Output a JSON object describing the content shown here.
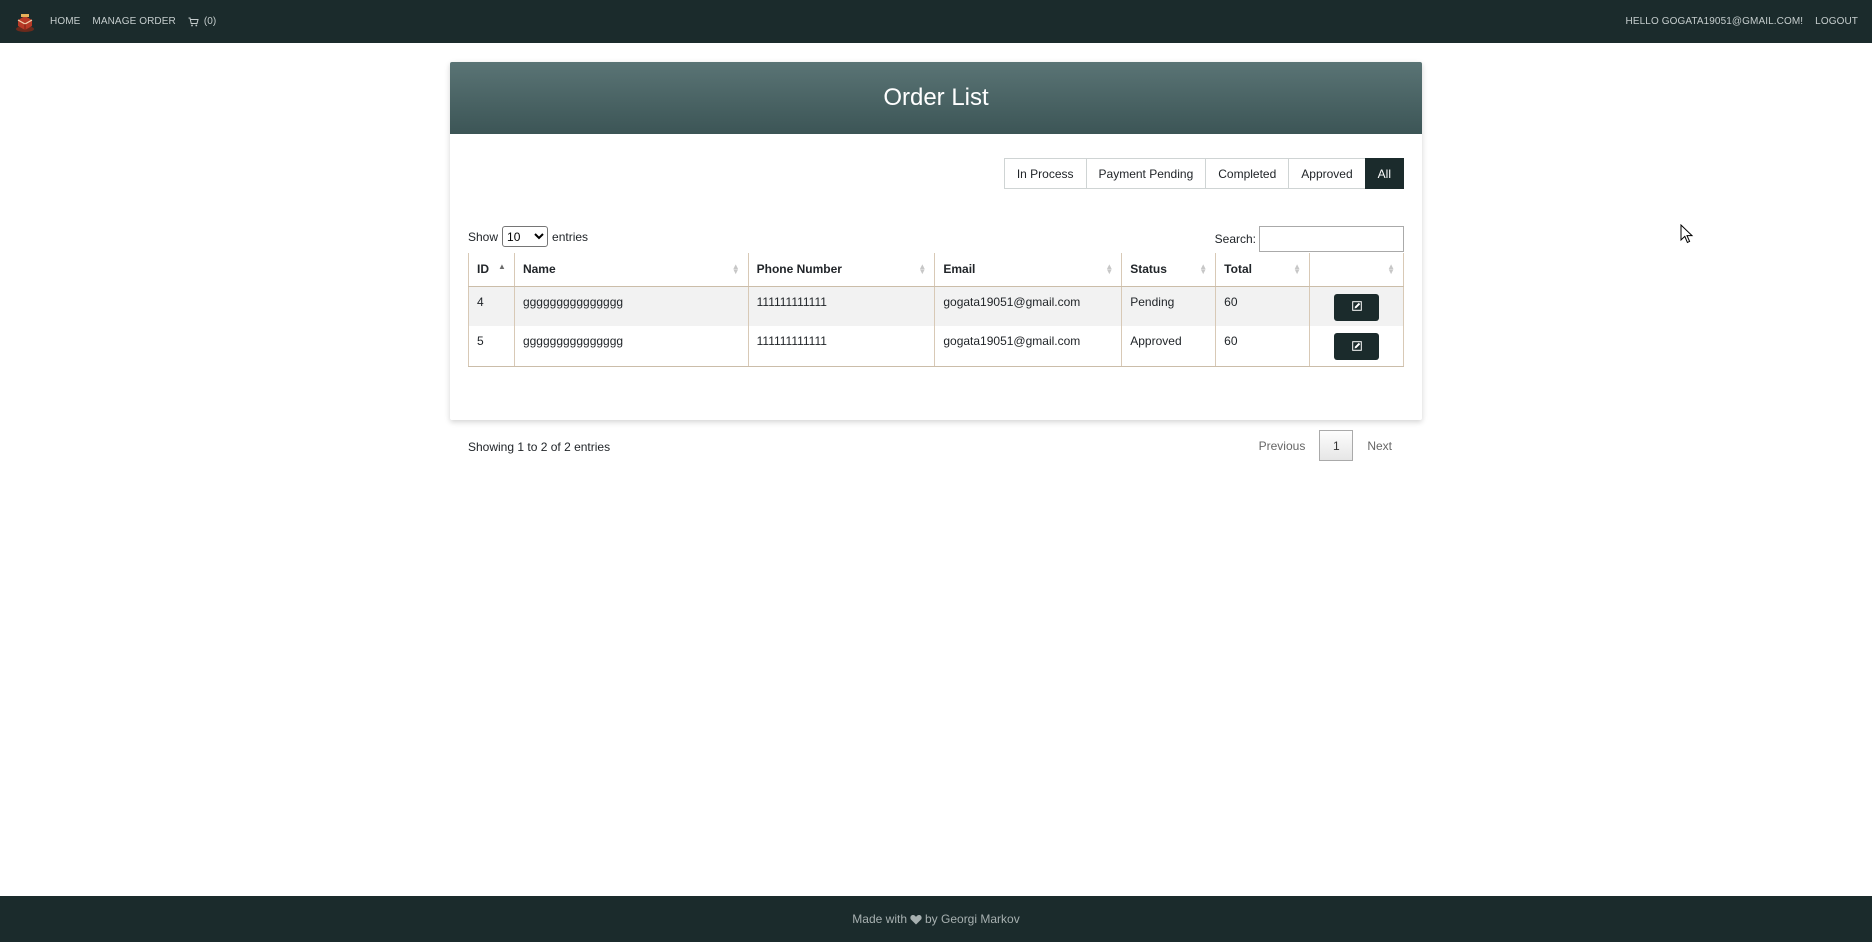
{
  "nav": {
    "home": "HOME",
    "manage_order": "MANAGE ORDER",
    "cart_count": "(0)",
    "greeting": "HELLO GOGATA19051@GMAIL.COM!",
    "logout": "LOGOUT"
  },
  "card": {
    "title": "Order List"
  },
  "filters": [
    {
      "label": "In Process",
      "active": false
    },
    {
      "label": "Payment Pending",
      "active": false
    },
    {
      "label": "Completed",
      "active": false
    },
    {
      "label": "Approved",
      "active": false
    },
    {
      "label": "All",
      "active": true
    }
  ],
  "table_controls": {
    "show": "Show",
    "entries_value": "10",
    "entries": "entries",
    "search_label": "Search:",
    "search_value": ""
  },
  "columns": [
    "ID",
    "Name",
    "Phone Number",
    "Email",
    "Status",
    "Total",
    ""
  ],
  "rows": [
    {
      "id": "4",
      "name": "ggggggggggggggg",
      "phone": "111111111111",
      "email": "gogata19051@gmail.com",
      "status": "Pending",
      "total": "60"
    },
    {
      "id": "5",
      "name": "ggggggggggggggg",
      "phone": "111111111111",
      "email": "gogata19051@gmail.com",
      "status": "Approved",
      "total": "60"
    }
  ],
  "pagination": {
    "info": "Showing 1 to 2 of 2 entries",
    "previous": "Previous",
    "current": "1",
    "next": "Next"
  },
  "footer": {
    "made_with": "Made with",
    "by": "by Georgi Markov"
  },
  "icons": [
    "logo-icon",
    "cart-icon",
    "edit-icon",
    "heart-icon",
    "cursor-icon"
  ],
  "colors": {
    "navbar": "#1b2b2c",
    "header_gradient_top": "#5a7475",
    "header_gradient_bottom": "#3c5556",
    "accent": "#1b2b2c"
  }
}
